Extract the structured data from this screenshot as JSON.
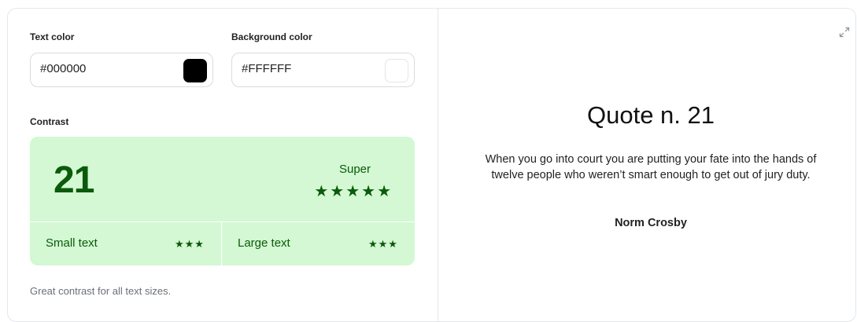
{
  "text_color": {
    "label": "Text color",
    "value": "#000000",
    "swatch": "#000000"
  },
  "background_color": {
    "label": "Background color",
    "value": "#FFFFFF",
    "swatch": "#FFFFFF"
  },
  "contrast": {
    "label": "Contrast",
    "ratio": "21",
    "rating": "Super",
    "rating_stars": "★★★★★",
    "small_text_label": "Small text",
    "small_text_stars": "★★★",
    "large_text_label": "Large text",
    "large_text_stars": "★★★",
    "description": "Great contrast for all text sizes.",
    "pass_bg": "#d3f8d3",
    "pass_fg": "#0b5a0b"
  },
  "preview": {
    "title": "Quote n. 21",
    "text": "When you go into court you are putting your fate into the hands of twelve people who weren’t smart enough to get out of jury duty.",
    "author": "Norm Crosby",
    "expand_icon": "expand-icon"
  }
}
